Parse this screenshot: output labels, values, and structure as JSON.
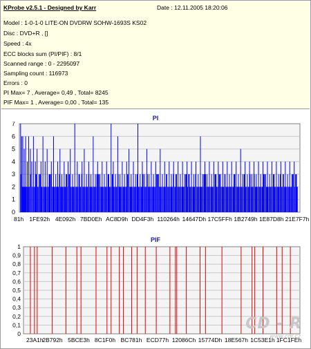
{
  "header": {
    "app_title": "KProbe v2.5.1 - Designed by Karr",
    "date": "Date : 12.11.2005 18:20:06",
    "lines": [
      "Model : 1-0-1-0 LITE-ON DVDRW SOHW-1693S KS02",
      "Disc : DVD+R ,  []",
      "Speed : 4x",
      "ECC blocks sum (PI/PIF) : 8/1",
      "Scanned range : 0 - 2295097",
      "Sampling count : 116973",
      "Errors : 0",
      "PI Max= 7 , Average= 0,49 , Total= 8245",
      "PIF Max= 1 , Average= 0,00 , Total= 135"
    ]
  },
  "colors": {
    "pi_bar": "#0000ff",
    "pif_bar": "#e00000",
    "title_blue": "#1a1aa8",
    "plot_bg": "#f4f4f4",
    "grid": "#c8c8c8"
  },
  "watermark": {
    "logo": "CD - R",
    "url": "www.cdr.cz"
  },
  "chart_data": [
    {
      "type": "bar",
      "title": "PI",
      "ylim": [
        0,
        7
      ],
      "yticks": [
        "0",
        "1",
        "2",
        "3",
        "4",
        "5",
        "6",
        "7"
      ],
      "x_tick_labels": [
        "81h",
        "1FE92h",
        "4E092h",
        "7BD0Eh",
        "AC8D9h",
        "DD4F3h",
        "110264h",
        "14647Dh",
        "17C5FFh",
        "1B2749h",
        "1E87D8h",
        "21E7F7h"
      ],
      "x_range": [
        0,
        2295097
      ],
      "grid": true,
      "max": 7,
      "average": 0.49,
      "total": 8245,
      "baseline_level": 2,
      "spikes": [
        {
          "pos": 0.002,
          "value": 7
        },
        {
          "pos": 0.006,
          "value": 6
        },
        {
          "pos": 0.01,
          "value": 6
        },
        {
          "pos": 0.015,
          "value": 5
        },
        {
          "pos": 0.02,
          "value": 6
        },
        {
          "pos": 0.026,
          "value": 4
        },
        {
          "pos": 0.031,
          "value": 6
        },
        {
          "pos": 0.037,
          "value": 5
        },
        {
          "pos": 0.042,
          "value": 4
        },
        {
          "pos": 0.048,
          "value": 6
        },
        {
          "pos": 0.055,
          "value": 4
        },
        {
          "pos": 0.061,
          "value": 5
        },
        {
          "pos": 0.068,
          "value": 3
        },
        {
          "pos": 0.075,
          "value": 4
        },
        {
          "pos": 0.082,
          "value": 6
        },
        {
          "pos": 0.09,
          "value": 4
        },
        {
          "pos": 0.097,
          "value": 5
        },
        {
          "pos": 0.104,
          "value": 3
        },
        {
          "pos": 0.112,
          "value": 4
        },
        {
          "pos": 0.12,
          "value": 6
        },
        {
          "pos": 0.128,
          "value": 3
        },
        {
          "pos": 0.135,
          "value": 4
        },
        {
          "pos": 0.143,
          "value": 5
        },
        {
          "pos": 0.15,
          "value": 3
        },
        {
          "pos": 0.158,
          "value": 4
        },
        {
          "pos": 0.165,
          "value": 3
        },
        {
          "pos": 0.172,
          "value": 4
        },
        {
          "pos": 0.18,
          "value": 5
        },
        {
          "pos": 0.188,
          "value": 3
        },
        {
          "pos": 0.196,
          "value": 7
        },
        {
          "pos": 0.205,
          "value": 4
        },
        {
          "pos": 0.213,
          "value": 3
        },
        {
          "pos": 0.222,
          "value": 4
        },
        {
          "pos": 0.23,
          "value": 5
        },
        {
          "pos": 0.238,
          "value": 3
        },
        {
          "pos": 0.246,
          "value": 4
        },
        {
          "pos": 0.254,
          "value": 3
        },
        {
          "pos": 0.262,
          "value": 6
        },
        {
          "pos": 0.27,
          "value": 3
        },
        {
          "pos": 0.278,
          "value": 4
        },
        {
          "pos": 0.286,
          "value": 3
        },
        {
          "pos": 0.294,
          "value": 4
        },
        {
          "pos": 0.302,
          "value": 3
        },
        {
          "pos": 0.31,
          "value": 4
        },
        {
          "pos": 0.318,
          "value": 3
        },
        {
          "pos": 0.326,
          "value": 7
        },
        {
          "pos": 0.334,
          "value": 4
        },
        {
          "pos": 0.342,
          "value": 3
        },
        {
          "pos": 0.35,
          "value": 6
        },
        {
          "pos": 0.358,
          "value": 3
        },
        {
          "pos": 0.366,
          "value": 4
        },
        {
          "pos": 0.374,
          "value": 3
        },
        {
          "pos": 0.382,
          "value": 4
        },
        {
          "pos": 0.39,
          "value": 5
        },
        {
          "pos": 0.398,
          "value": 3
        },
        {
          "pos": 0.406,
          "value": 4
        },
        {
          "pos": 0.414,
          "value": 3
        },
        {
          "pos": 0.422,
          "value": 7
        },
        {
          "pos": 0.43,
          "value": 3
        },
        {
          "pos": 0.438,
          "value": 4
        },
        {
          "pos": 0.446,
          "value": 3
        },
        {
          "pos": 0.454,
          "value": 5
        },
        {
          "pos": 0.462,
          "value": 3
        },
        {
          "pos": 0.47,
          "value": 4
        },
        {
          "pos": 0.478,
          "value": 3
        },
        {
          "pos": 0.486,
          "value": 4
        },
        {
          "pos": 0.494,
          "value": 3
        },
        {
          "pos": 0.502,
          "value": 5
        },
        {
          "pos": 0.51,
          "value": 3
        },
        {
          "pos": 0.518,
          "value": 4
        },
        {
          "pos": 0.526,
          "value": 3
        },
        {
          "pos": 0.534,
          "value": 4
        },
        {
          "pos": 0.542,
          "value": 3
        },
        {
          "pos": 0.55,
          "value": 4
        },
        {
          "pos": 0.558,
          "value": 3
        },
        {
          "pos": 0.566,
          "value": 4
        },
        {
          "pos": 0.574,
          "value": 3
        },
        {
          "pos": 0.582,
          "value": 4
        },
        {
          "pos": 0.59,
          "value": 3
        },
        {
          "pos": 0.598,
          "value": 4
        },
        {
          "pos": 0.606,
          "value": 3
        },
        {
          "pos": 0.614,
          "value": 4
        },
        {
          "pos": 0.622,
          "value": 3
        },
        {
          "pos": 0.63,
          "value": 4
        },
        {
          "pos": 0.638,
          "value": 3
        },
        {
          "pos": 0.646,
          "value": 6
        },
        {
          "pos": 0.654,
          "value": 3
        },
        {
          "pos": 0.662,
          "value": 4
        },
        {
          "pos": 0.67,
          "value": 3
        },
        {
          "pos": 0.678,
          "value": 4
        },
        {
          "pos": 0.686,
          "value": 3
        },
        {
          "pos": 0.694,
          "value": 4
        },
        {
          "pos": 0.702,
          "value": 3
        },
        {
          "pos": 0.71,
          "value": 4
        },
        {
          "pos": 0.718,
          "value": 3
        },
        {
          "pos": 0.726,
          "value": 4
        },
        {
          "pos": 0.734,
          "value": 3
        },
        {
          "pos": 0.742,
          "value": 4
        },
        {
          "pos": 0.75,
          "value": 3
        },
        {
          "pos": 0.758,
          "value": 4
        },
        {
          "pos": 0.766,
          "value": 3
        },
        {
          "pos": 0.774,
          "value": 4
        },
        {
          "pos": 0.782,
          "value": 3
        },
        {
          "pos": 0.79,
          "value": 5
        },
        {
          "pos": 0.798,
          "value": 3
        },
        {
          "pos": 0.806,
          "value": 4
        },
        {
          "pos": 0.814,
          "value": 3
        },
        {
          "pos": 0.822,
          "value": 4
        },
        {
          "pos": 0.83,
          "value": 3
        },
        {
          "pos": 0.838,
          "value": 4
        },
        {
          "pos": 0.846,
          "value": 3
        },
        {
          "pos": 0.854,
          "value": 4
        },
        {
          "pos": 0.862,
          "value": 3
        },
        {
          "pos": 0.87,
          "value": 4
        },
        {
          "pos": 0.878,
          "value": 3
        },
        {
          "pos": 0.886,
          "value": 4
        },
        {
          "pos": 0.894,
          "value": 3
        },
        {
          "pos": 0.902,
          "value": 4
        },
        {
          "pos": 0.91,
          "value": 3
        },
        {
          "pos": 0.918,
          "value": 4
        },
        {
          "pos": 0.926,
          "value": 3
        },
        {
          "pos": 0.934,
          "value": 4
        },
        {
          "pos": 0.942,
          "value": 3
        },
        {
          "pos": 0.95,
          "value": 4
        },
        {
          "pos": 0.958,
          "value": 3
        },
        {
          "pos": 0.966,
          "value": 4
        },
        {
          "pos": 0.974,
          "value": 3
        },
        {
          "pos": 0.982,
          "value": 4
        },
        {
          "pos": 0.99,
          "value": 3
        }
      ]
    },
    {
      "type": "bar",
      "title": "PIF",
      "ylim": [
        0,
        1
      ],
      "yticks": [
        "0",
        "0,1",
        "0,2",
        "0,3",
        "0,4",
        "0,5",
        "0,6",
        "0,7",
        "0,8",
        "0,9",
        "1"
      ],
      "x_tick_labels": [
        "23A1h",
        "2B792h",
        "5BCE3h",
        "8C1F0h",
        "BC781h",
        "ECD77h",
        "12086Ch",
        "15774Dh",
        "18E567h",
        "1C53E1h",
        "1FC1FEh"
      ],
      "x_range": [
        0,
        2295097
      ],
      "grid": true,
      "max": 1,
      "average": 0.0,
      "total": 135,
      "event_positions": [
        0.02,
        0.035,
        0.045,
        0.1,
        0.15,
        0.19,
        0.205,
        0.26,
        0.3,
        0.315,
        0.345,
        0.36,
        0.39,
        0.41,
        0.44,
        0.48,
        0.53,
        0.55,
        0.555,
        0.59,
        0.64,
        0.66,
        0.72,
        0.79,
        0.83,
        0.84,
        0.87,
        0.92,
        0.94,
        0.97
      ]
    }
  ]
}
